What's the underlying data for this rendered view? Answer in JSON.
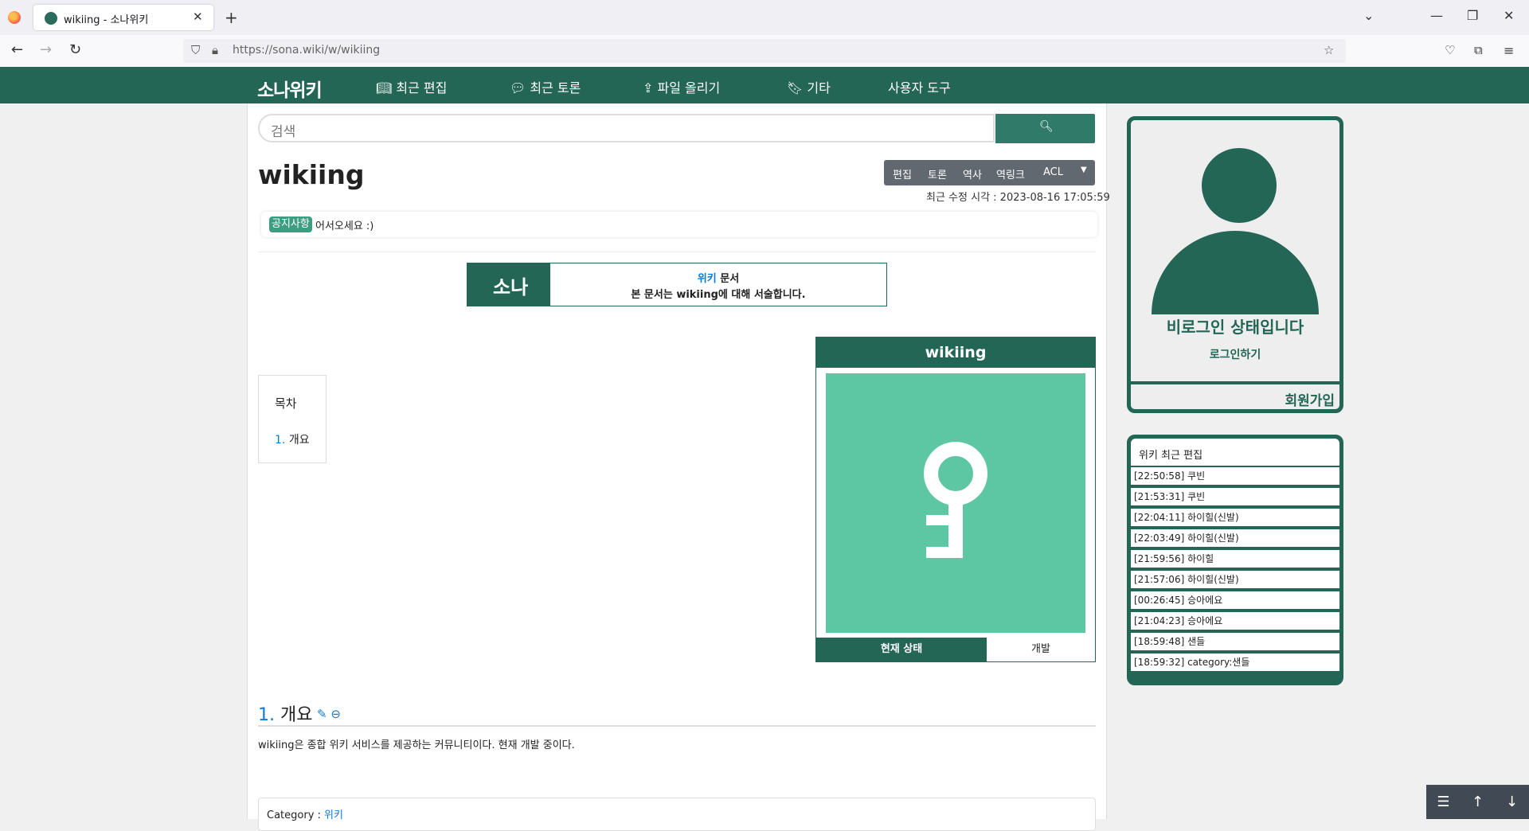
{
  "browser": {
    "tab_title": "wikiing - 소나위키",
    "url": "https://sona.wiki/w/wikiing"
  },
  "site": {
    "logo": "소나위키",
    "menu": [
      {
        "icon": "book-icon",
        "label": "최근 편집"
      },
      {
        "icon": "comments-icon",
        "label": "최근 토론"
      },
      {
        "icon": "upload-icon",
        "label": "파일 올리기"
      },
      {
        "icon": "bookmark-icon",
        "label": "기타"
      },
      {
        "icon": "",
        "label": "사용자 도구"
      }
    ],
    "accent_color": "#236656"
  },
  "search": {
    "placeholder": "검색"
  },
  "page": {
    "title": "wikiing",
    "toolbar": [
      "편집",
      "토론",
      "역사",
      "역링크",
      "ACL"
    ],
    "last_modified": "최근 수정 시각 : 2023-08-16 17:05:59"
  },
  "notice": {
    "badge": "공지사항",
    "text": "어서오세요 :)"
  },
  "banner": {
    "logo": "소나",
    "line1_link": "위키",
    "line1_rest": " 문서",
    "line2": "본 문서는 wikiing에 대해 서술합니다."
  },
  "toc": {
    "title": "목차",
    "items": [
      {
        "num": "1.",
        "label": "개요"
      }
    ]
  },
  "infobox": {
    "title": "wikiing",
    "image_icon": "key-icon",
    "tabs": [
      "현재 상태",
      "개발"
    ]
  },
  "section": {
    "num": "1.",
    "title": "개요",
    "body": "wikiing은 종합 위키 서비스를 제공하는 커뮤니티이다. 현재 개발 중이다."
  },
  "category": {
    "label": "Category : ",
    "value": "위키"
  },
  "sidebar": {
    "status": "비로그인 상태입니다",
    "login": "로그인하기",
    "signup": "회원가입",
    "recent_title": "위키 최근 편집",
    "recent": [
      "[22:50:58] 쿠빈",
      "[21:53:31] 쿠빈",
      "[22:04:11] 하이힐(신발)",
      "[22:03:49] 하이힐(신발)",
      "[21:59:56] 하이힐",
      "[21:57:06] 하이힐(신발)",
      "[00:26:45] 승아에요",
      "[21:04:23] 승아에요",
      "[18:59:48] 샌들",
      "[18:59:32] category:샌들"
    ]
  }
}
